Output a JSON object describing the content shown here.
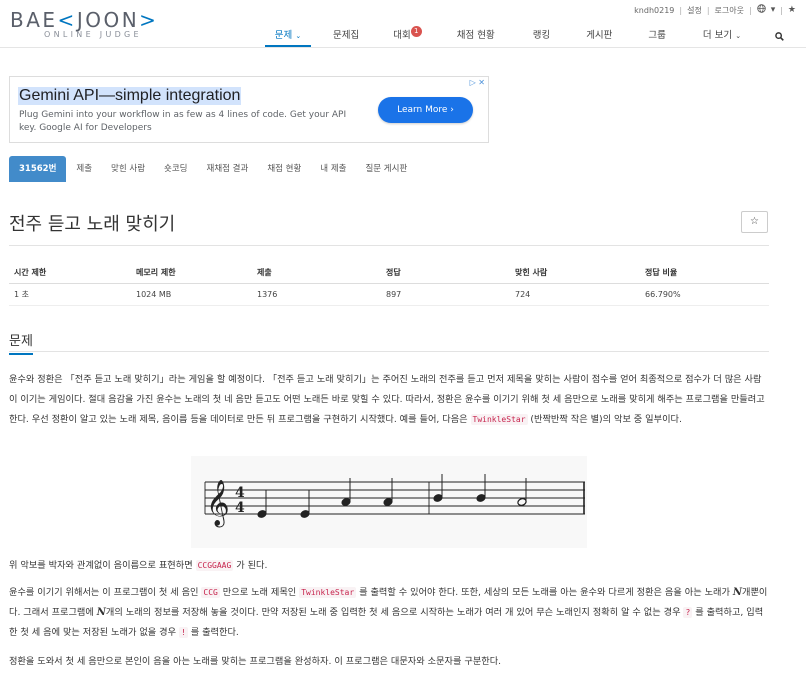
{
  "util": {
    "username": "kndh0219",
    "settings": "설정",
    "logout": "로그아웃"
  },
  "logo": {
    "main_left": "BAE",
    "main_right": "JOON",
    "sub": "ONLINE JUDGE"
  },
  "nav": {
    "items": [
      "문제",
      "문제집",
      "대회",
      "채점 현황",
      "랭킹",
      "게시판",
      "그룹",
      "더 보기"
    ],
    "contest_badge": "1",
    "accent": "#0076c0"
  },
  "ad": {
    "title": "Gemini API—simple integration",
    "desc": "Plug Gemini into your workflow in as few as 4 lines of code. Get your API key. Google AI for Developers",
    "button": "Learn More"
  },
  "tabs": [
    "31562번",
    "제출",
    "맞힌 사람",
    "숏코딩",
    "재채점 결과",
    "채점 현황",
    "내 제출",
    "질문 게시판"
  ],
  "problem": {
    "title": "전주 듣고 노래 맞히기",
    "star": "☆"
  },
  "info": {
    "headers": [
      "시간 제한",
      "메모리 제한",
      "제출",
      "정답",
      "맞힌 사람",
      "정답 비율"
    ],
    "values": [
      "1 초",
      "1024 MB",
      "1376",
      "897",
      "724",
      "66.790%"
    ]
  },
  "section": {
    "title": "문제"
  },
  "p1": {
    "a": "윤수와 정환은 「전주 듣고 노래 맞히기」라는 게임을 할 예정이다. 「전주 듣고 노래 맞히기」는 주어진 노래의 전주를 듣고 먼저 제목을 맞히는 사람이 점수를 얻어 최종적으로 점수가 더 많은 사람이 이기는 게임이다. 절대 음감을 가진 윤수는 노래의 첫 네 음만 듣고도 어떤 노래든 바로 맞힐 수 있다. 따라서, 정환은 윤수를 이기기 위해 첫 세 음만으로 노래를 맞히게 해주는 프로그램을 만들려고 한다. 우선 정환이 알고 있는 노래 제목, 음이름 등을 데이터로 만든 뒤 프로그램을 구현하기 시작했다. 예를 들어, 다음은 ",
    "code": "TwinkleStar",
    "b": " (반짝반짝 작은 별)의 악보 중 일부이다."
  },
  "p2": {
    "a": "위 악보를 박자와 관계없이 음이름으로 표현하면 ",
    "code": "CCGGAAG",
    "b": " 가 된다."
  },
  "p3": {
    "a": "윤수를 이기기 위해서는 이 프로그램이 첫 세 음인 ",
    "code1": "CCG",
    "b": " 만으로 노래 제목인 ",
    "code2": "TwinkleStar",
    "c": " 를 출력할 수 있어야 한다. 또한, 세상의 모든 노래를 아는 윤수와 다르게 정환은 음을 아는 노래가 ",
    "var1": "N",
    "d": "개뿐이다. 그래서 프로그램에 ",
    "var2": "N",
    "e": "개의 노래의 정보를 저장해 놓을 것이다. 만약 저장된 노래 중 입력한 첫 세 음으로 시작하는 노래가 여러 개 있어 무슨 노래인지 정확히 알 수 없는 경우 ",
    "code3": "?",
    "f": " 를 출력하고, 입력한 첫 세 음에 맞는 저장된 노래가 없을 경우 ",
    "code4": "!",
    "g": " 를 출력한다."
  },
  "p4": {
    "text": "정환을 도와서 첫 세 음만으로 본인이 음을 아는 노래를 맞히는 프로그램을 완성하자. 이 프로그램은 대문자와 소문자를 구분한다."
  }
}
